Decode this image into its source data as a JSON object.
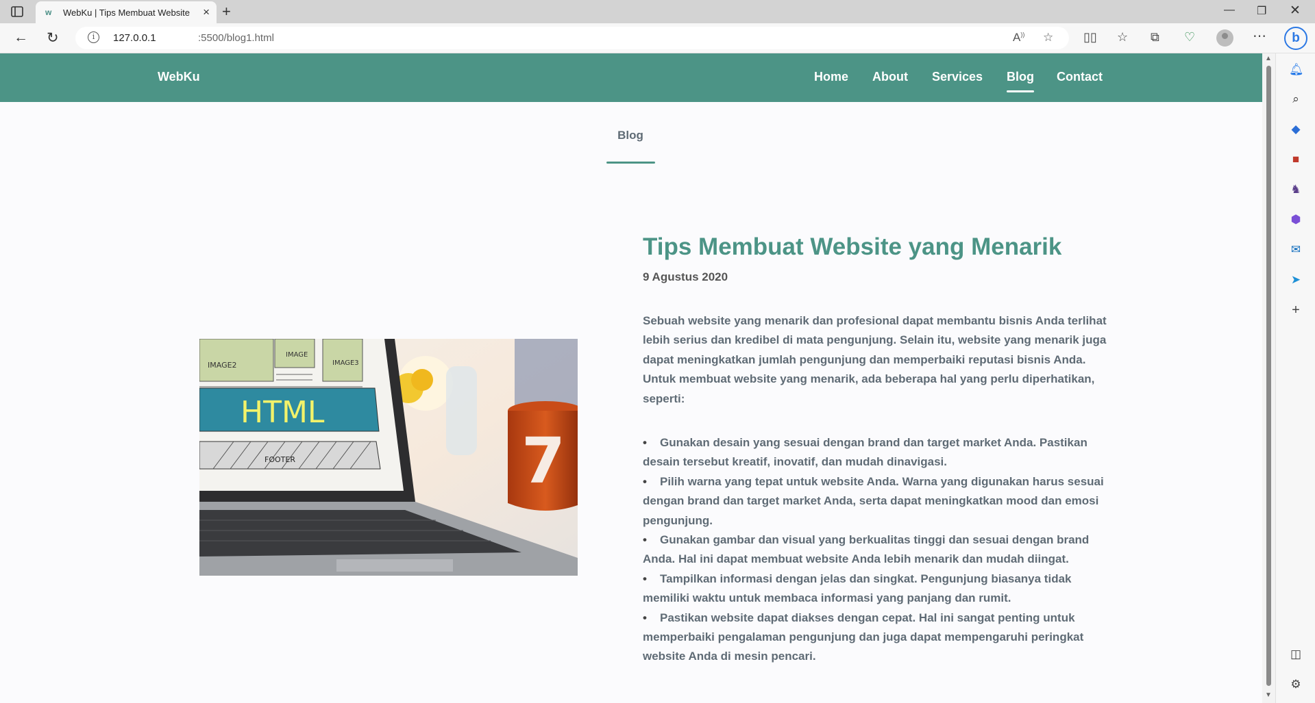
{
  "browser": {
    "tab_title": "WebKu | Tips Membuat Website",
    "url_host": "127.0.0.1",
    "url_path": ":5500/blog1.html"
  },
  "site": {
    "brand": "WebKu",
    "nav": [
      {
        "label": "Home"
      },
      {
        "label": "About"
      },
      {
        "label": "Services"
      },
      {
        "label": "Blog"
      },
      {
        "label": "Contact"
      }
    ],
    "section_title": "Blog",
    "image_text": {
      "main": "HTML",
      "image2": "IMAGE2",
      "image": "IMAGE",
      "image3": "IMAGE3",
      "footer": "FOOTER",
      "mug": "7"
    },
    "post": {
      "title": "Tips Membuat Website yang Menarik",
      "date": "9 Agustus 2020",
      "intro": "Sebuah website yang menarik dan profesional dapat membantu bisnis Anda terlihat lebih serius dan kredibel di mata pengunjung. Selain itu, website yang menarik juga dapat meningkatkan jumlah pengunjung dan memperbaiki reputasi bisnis Anda. Untuk membuat website yang menarik, ada beberapa hal yang perlu diperhatikan, seperti:",
      "tips": [
        "Gunakan desain yang sesuai dengan brand dan target market Anda. Pastikan desain tersebut kreatif, inovatif, dan mudah dinavigasi.",
        "Pilih warna yang tepat untuk website Anda. Warna yang digunakan harus sesuai dengan brand dan target market Anda, serta dapat meningkatkan mood dan emosi pengunjung.",
        "Gunakan gambar dan visual yang berkualitas tinggi dan sesuai dengan brand Anda. Hal ini dapat membuat website Anda lebih menarik dan mudah diingat.",
        "Tampilkan informasi dengan jelas dan singkat. Pengunjung biasanya tidak memiliki waktu untuk membaca informasi yang panjang dan rumit.",
        "Pastikan website dapat diakses dengan cepat. Hal ini sangat penting untuk memperbaiki pengalaman pengunjung dan juga dapat mempengaruhi peringkat website Anda di mesin pencari."
      ]
    }
  },
  "colors": {
    "accent": "#4c9486",
    "text": "#5f6b75"
  }
}
